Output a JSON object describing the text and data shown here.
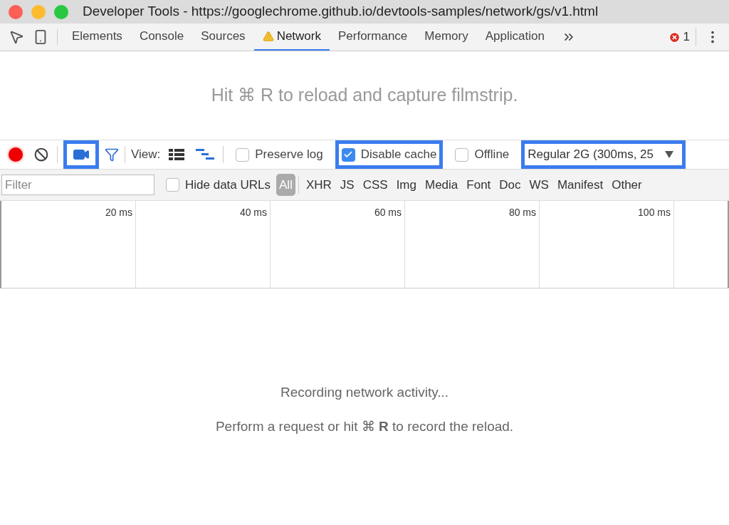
{
  "window": {
    "title": "Developer Tools - https://googlechrome.github.io/devtools-samples/network/gs/v1.html"
  },
  "tabs": [
    {
      "label": "Elements",
      "selected": false,
      "warning": false
    },
    {
      "label": "Console",
      "selected": false,
      "warning": false
    },
    {
      "label": "Sources",
      "selected": false,
      "warning": false
    },
    {
      "label": "Network",
      "selected": true,
      "warning": true
    },
    {
      "label": "Performance",
      "selected": false,
      "warning": false
    },
    {
      "label": "Memory",
      "selected": false,
      "warning": false
    },
    {
      "label": "Application",
      "selected": false,
      "warning": false
    }
  ],
  "error_count": "1",
  "filmstrip_hint": "Hit ⌘ R to reload and capture filmstrip.",
  "toolbar": {
    "recording": true,
    "screenshots": {
      "on": true,
      "highlighted": true
    },
    "view_label": "View:",
    "large_rows": false,
    "overview": true,
    "checkboxes": [
      {
        "label": "Preserve log",
        "checked": false,
        "highlighted": false
      },
      {
        "label": "Disable cache",
        "checked": true,
        "highlighted": true
      },
      {
        "label": "Offline",
        "checked": false,
        "highlighted": false
      }
    ],
    "throttle": {
      "value": "Regular 2G (300ms, 25",
      "highlighted": true
    }
  },
  "filter_bar": {
    "placeholder": "Filter",
    "hide_data_urls": {
      "label": "Hide data URLs",
      "checked": false
    },
    "types": [
      {
        "label": "All",
        "selected": true
      },
      {
        "label": "XHR",
        "selected": false
      },
      {
        "label": "JS",
        "selected": false
      },
      {
        "label": "CSS",
        "selected": false
      },
      {
        "label": "Img",
        "selected": false
      },
      {
        "label": "Media",
        "selected": false
      },
      {
        "label": "Font",
        "selected": false
      },
      {
        "label": "Doc",
        "selected": false
      },
      {
        "label": "WS",
        "selected": false
      },
      {
        "label": "Manifest",
        "selected": false
      },
      {
        "label": "Other",
        "selected": false
      }
    ]
  },
  "timeline": {
    "ticks": [
      "20 ms",
      "40 ms",
      "60 ms",
      "80 ms",
      "100 ms"
    ]
  },
  "empty_state": {
    "title": "Recording network activity...",
    "hint": "Perform a request or hit ⌘ **R** to record the reload."
  }
}
